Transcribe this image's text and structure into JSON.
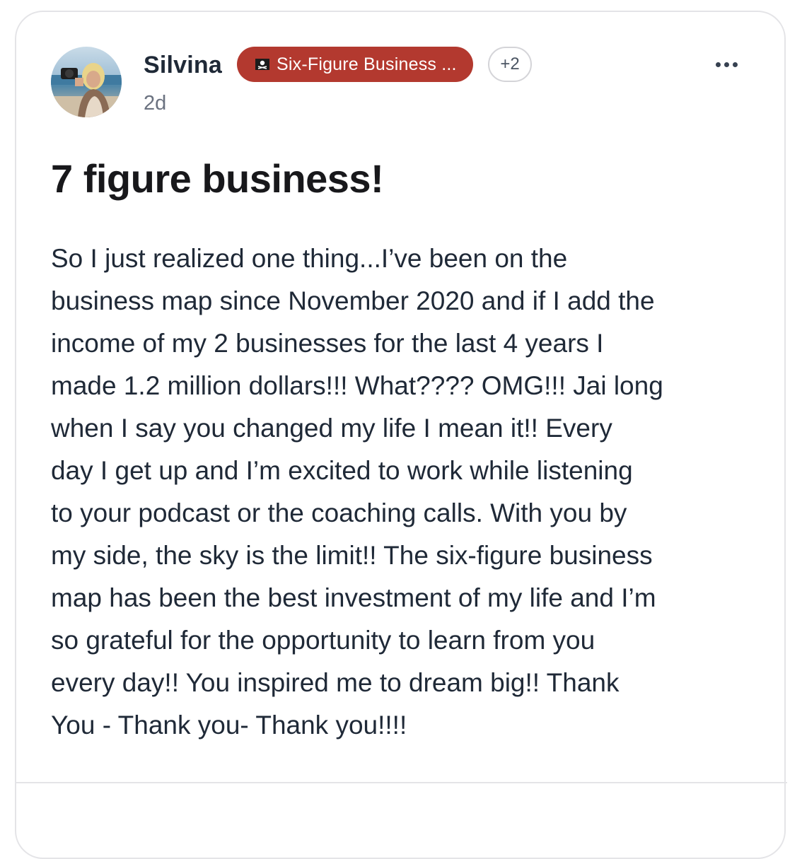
{
  "post": {
    "author": "Silvina",
    "timestamp": "2d",
    "category_badge": "Six-Figure Business ...",
    "extra_categories": "+2",
    "title": "7 figure business!",
    "body_lines": [
      "So I just realized one thing...I’ve been on the",
      "business map since November 2020 and if I add the",
      "income of my 2 businesses for the last 4 years I",
      "made 1.2 million dollars!!! What???? OMG!!! Jai long",
      "when I say you changed my life I mean it!! Every",
      "day I get up and I’m excited to work while listening",
      "to your podcast or the coaching calls. With you by",
      "my side, the sky is the limit!! The six-figure business",
      "map has been the best investment of my life and I’m",
      "so grateful for the opportunity to learn from you",
      "every day!! You inspired me to dream big!! Thank",
      "You - Thank you- Thank you!!!!"
    ]
  },
  "icons": {
    "badge_icon": "pirate-flag-icon",
    "menu_icon": "more-options-icon"
  },
  "colors": {
    "badge_background": "#b3392f",
    "title_text": "#18181b",
    "body_text": "#1f2937",
    "muted_text": "#6b7280",
    "border": "#e4e4e7"
  }
}
